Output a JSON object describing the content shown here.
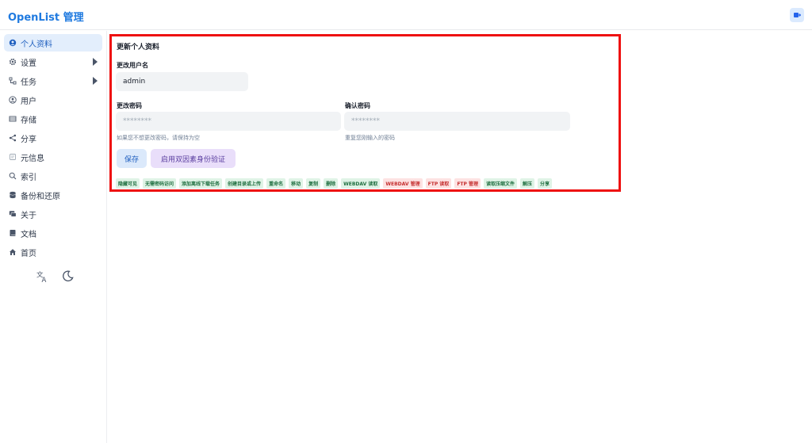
{
  "app": {
    "title": "OpenList 管理"
  },
  "sidebar": {
    "items": [
      {
        "label": "个人资料",
        "icon": "user-circle-icon",
        "active": true,
        "expandable": false
      },
      {
        "label": "设置",
        "icon": "gear-icon",
        "active": false,
        "expandable": true
      },
      {
        "label": "任务",
        "icon": "flow-icon",
        "active": false,
        "expandable": true
      },
      {
        "label": "用户",
        "icon": "user-icon",
        "active": false,
        "expandable": false
      },
      {
        "label": "存储",
        "icon": "storage-icon",
        "active": false,
        "expandable": false
      },
      {
        "label": "分享",
        "icon": "share-icon",
        "active": false,
        "expandable": false
      },
      {
        "label": "元信息",
        "icon": "meta-icon",
        "active": false,
        "expandable": false
      },
      {
        "label": "索引",
        "icon": "search-icon",
        "active": false,
        "expandable": false
      },
      {
        "label": "备份和还原",
        "icon": "database-icon",
        "active": false,
        "expandable": false
      },
      {
        "label": "关于",
        "icon": "chat-icon",
        "active": false,
        "expandable": false
      },
      {
        "label": "文档",
        "icon": "book-icon",
        "active": false,
        "expandable": false
      },
      {
        "label": "首页",
        "icon": "home-icon",
        "active": false,
        "expandable": false
      }
    ]
  },
  "profile": {
    "title": "更新个人资料",
    "username_label": "更改用户名",
    "username_value": "admin",
    "password_label": "更改密码",
    "password_placeholder": "********",
    "password_hint": "如果您不想更改密码，请保持为空",
    "confirm_label": "确认密码",
    "confirm_placeholder": "********",
    "confirm_hint": "重复您刚输入的密码",
    "save_label": "保存",
    "twofa_label": "启用双因素身份验证"
  },
  "permissions": [
    {
      "label": "隐藏可见",
      "enabled": true
    },
    {
      "label": "无需密码访问",
      "enabled": true
    },
    {
      "label": "添加离线下载任务",
      "enabled": true
    },
    {
      "label": "创建目录或上传",
      "enabled": true
    },
    {
      "label": "重命名",
      "enabled": true
    },
    {
      "label": "移动",
      "enabled": true
    },
    {
      "label": "复制",
      "enabled": true
    },
    {
      "label": "删除",
      "enabled": true
    },
    {
      "label": "WEBDAV 读取",
      "enabled": true
    },
    {
      "label": "WEBDAV 管理",
      "enabled": false
    },
    {
      "label": "FTP 读取",
      "enabled": false
    },
    {
      "label": "FTP 管理",
      "enabled": false
    },
    {
      "label": "读取压缩文件",
      "enabled": true
    },
    {
      "label": "解压",
      "enabled": true
    },
    {
      "label": "分享",
      "enabled": true
    }
  ],
  "colors": {
    "accent": "#1f7ae0",
    "highlight_border": "#ee1111",
    "enabled_tag": "#dff3e6",
    "disabled_tag": "#fde2e2"
  }
}
